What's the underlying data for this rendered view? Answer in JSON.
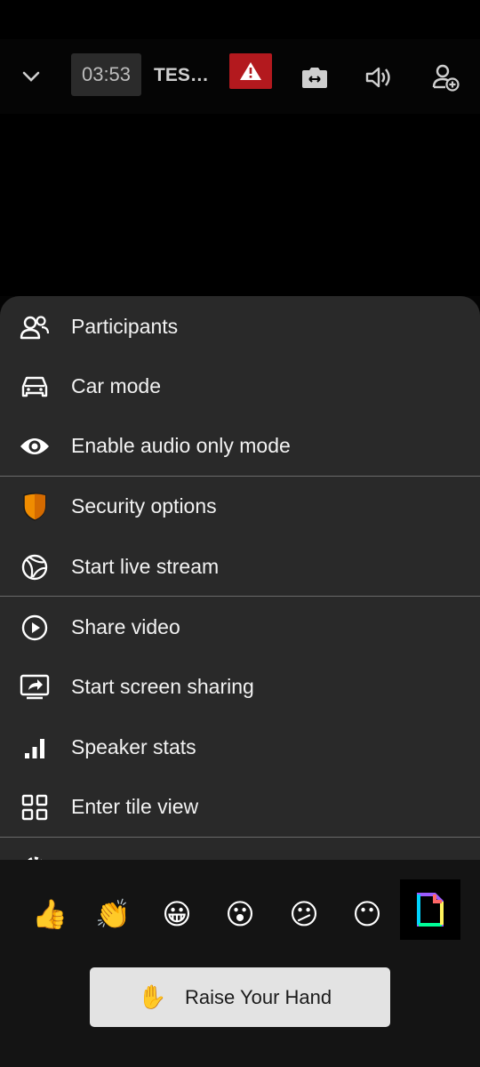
{
  "header": {
    "timer": "03:53",
    "room_name": "TES…",
    "icons": [
      "chevron-down-icon",
      "warning-icon",
      "camera-switch-icon",
      "volume-icon",
      "add-participant-icon"
    ]
  },
  "menu": {
    "items": [
      {
        "label": "Participants",
        "icon": "participants-icon"
      },
      {
        "label": "Car mode",
        "icon": "car-icon"
      },
      {
        "label": "Enable audio only mode",
        "icon": "eye-icon"
      },
      {
        "label": "Security options",
        "icon": "shield-icon"
      },
      {
        "label": "Start live stream",
        "icon": "globe-icon"
      },
      {
        "label": "Share video",
        "icon": "play-circle-icon"
      },
      {
        "label": "Start screen sharing",
        "icon": "screen-share-icon"
      },
      {
        "label": "Speaker stats",
        "icon": "bar-chart-icon"
      },
      {
        "label": "Enter tile view",
        "icon": "tile-grid-icon"
      }
    ]
  },
  "reactions": {
    "emojis": [
      "👍",
      "👏",
      "😀",
      "😮",
      "😕",
      "😶"
    ],
    "raise_hand_emoji": "✋",
    "raise_hand_label": "Raise Your Hand"
  },
  "colors": {
    "sheet_background": "#292929",
    "alert_red": "#b3191e",
    "shield_orange": "#f08c00"
  }
}
